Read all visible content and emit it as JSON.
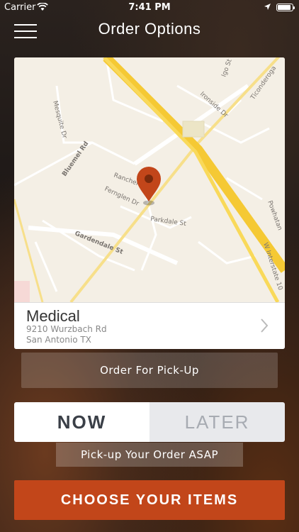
{
  "status_bar": {
    "carrier": "Carrier",
    "time": "7:41 PM",
    "battery_level": 0.9
  },
  "nav": {
    "title": "Order Options",
    "menu_icon": "hamburger-menu-icon"
  },
  "map": {
    "street_labels": [
      "Igo St",
      "Ticonderoga",
      "Ironside Dr",
      "Mesquite Dr",
      "Bluemel Rd",
      "Ranchero",
      "Fernglen Dr",
      "Parkdale St",
      "Powhatan",
      "W Interstate 10",
      "Gardendale St"
    ],
    "marker_icon": "map-pin-icon",
    "marker_color": "#c2461a"
  },
  "location": {
    "name": "Medical",
    "address_line1": "9210 Wurzbach Rd",
    "address_line2": "San Antonio TX"
  },
  "order_type_button": "Order For Pick-Up",
  "timing": {
    "now_label": "NOW",
    "later_label": "LATER",
    "selected": "NOW"
  },
  "asap_label": "Pick-up Your Order ASAP",
  "cta": {
    "label": "CHOOSE YOUR ITEMS",
    "color": "#c2461a"
  }
}
